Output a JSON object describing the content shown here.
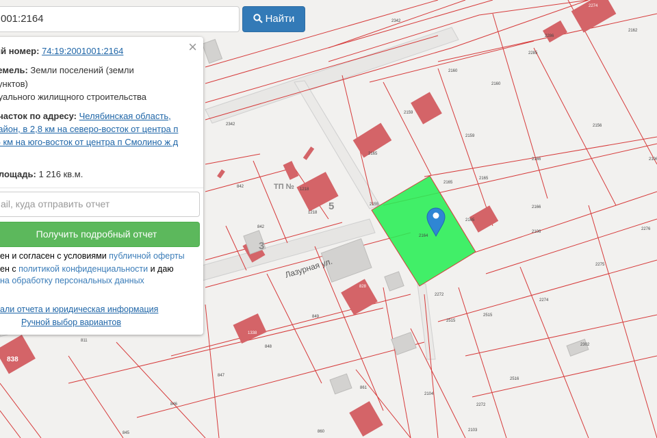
{
  "search": {
    "value": "001:2164",
    "button_label": "Найти"
  },
  "panel": {
    "cad_label": "ый номер:",
    "cad_value": "74:19:2001001:2164",
    "land_label": "земель:",
    "land_value_1": "Земли поселений (земли",
    "land_value_2": "пунктов)",
    "land_value_3": "дуального жилищного строительства",
    "addr_label": "участок по адресу:",
    "addr_1": "Челябинская область,",
    "addr_2": "район, в 2,8 км на северо-восток от центра п",
    "addr_3": ",5 км на юго-восток от центра п Смолино ж д",
    "area_label": "площадь:",
    "area_value": "1 216 кв.м.",
    "email_placeholder": "ail, куда отправить отчет",
    "report_button": "Получить подробный отчет",
    "terms_1a": "ен и согласен с условиями ",
    "terms_1b": "публичной оферты",
    "terms_2a": "ен с ",
    "terms_2b": "политикой конфиденциальности",
    "terms_2c": " и даю",
    "terms_3": "на обработку персональных данных",
    "details_link": "али отчета и юридическая информация",
    "manual_link": "Ручной выбор вариантов"
  },
  "map": {
    "street_name": "Лазурная ул.",
    "tp_label": "ТП №",
    "house_numbers": [
      "3",
      "5"
    ],
    "parcel_numbers": [
      "2342",
      "2160",
      "2159",
      "2160",
      "2156",
      "2342",
      "2159",
      "2166",
      "2165",
      "2165",
      "2166",
      "2106",
      "2165",
      "2106",
      "2155",
      "2276",
      "2275",
      "2274",
      "2272",
      "2515",
      "2515",
      "2302",
      "2516",
      "2104",
      "2272",
      "2103",
      "842",
      "842",
      "849",
      "848",
      "847",
      "846",
      "845",
      "861",
      "860",
      "811",
      "2285",
      "2162"
    ],
    "building_labels": [
      "2164",
      "1218",
      "838",
      "1338",
      "828",
      "2162"
    ],
    "selected_parcel": "74:19:2001001:2164",
    "colors": {
      "selected_fill": "#28ee55",
      "boundary": "#d63a3a",
      "building": "#d46468",
      "marker": "#2f86d4"
    }
  }
}
